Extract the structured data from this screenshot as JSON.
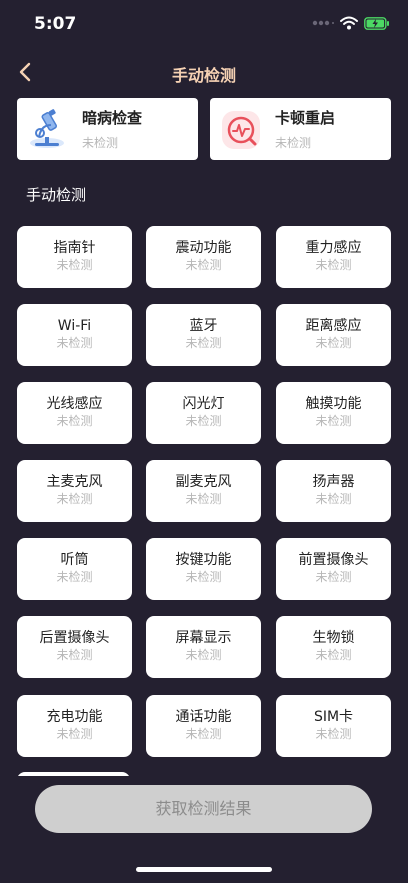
{
  "status_bar": {
    "time": "5:07"
  },
  "nav": {
    "title": "手动检测"
  },
  "top_cards": [
    {
      "title": "暗病检查",
      "status": "未检测",
      "icon": "microscope-icon"
    },
    {
      "title": "卡顿重启",
      "status": "未检测",
      "icon": "lag-restart-icon"
    }
  ],
  "section": {
    "title": "手动检测"
  },
  "items": [
    {
      "name": "指南针",
      "status": "未检测"
    },
    {
      "name": "震动功能",
      "status": "未检测"
    },
    {
      "name": "重力感应",
      "status": "未检测"
    },
    {
      "name": "Wi-Fi",
      "status": "未检测"
    },
    {
      "name": "蓝牙",
      "status": "未检测"
    },
    {
      "name": "距离感应",
      "status": "未检测"
    },
    {
      "name": "光线感应",
      "status": "未检测"
    },
    {
      "name": "闪光灯",
      "status": "未检测"
    },
    {
      "name": "触摸功能",
      "status": "未检测"
    },
    {
      "name": "主麦克风",
      "status": "未检测"
    },
    {
      "name": "副麦克风",
      "status": "未检测"
    },
    {
      "name": "扬声器",
      "status": "未检测"
    },
    {
      "name": "听筒",
      "status": "未检测"
    },
    {
      "name": "按键功能",
      "status": "未检测"
    },
    {
      "name": "前置摄像头",
      "status": "未检测"
    },
    {
      "name": "后置摄像头",
      "status": "未检测"
    },
    {
      "name": "屏幕显示",
      "status": "未检测"
    },
    {
      "name": "生物锁",
      "status": "未检测"
    },
    {
      "name": "充电功能",
      "status": "未检测"
    },
    {
      "name": "通话功能",
      "status": "未检测"
    },
    {
      "name": "SIM卡",
      "status": "未检测"
    }
  ],
  "footer": {
    "button_label": "获取检测结果"
  },
  "colors": {
    "background": "#242030",
    "title_accent": "#f6d2b4",
    "status_gray": "#b7b7b7",
    "button_disabled": "#cfcfcf",
    "battery_green": "#4cd964"
  }
}
